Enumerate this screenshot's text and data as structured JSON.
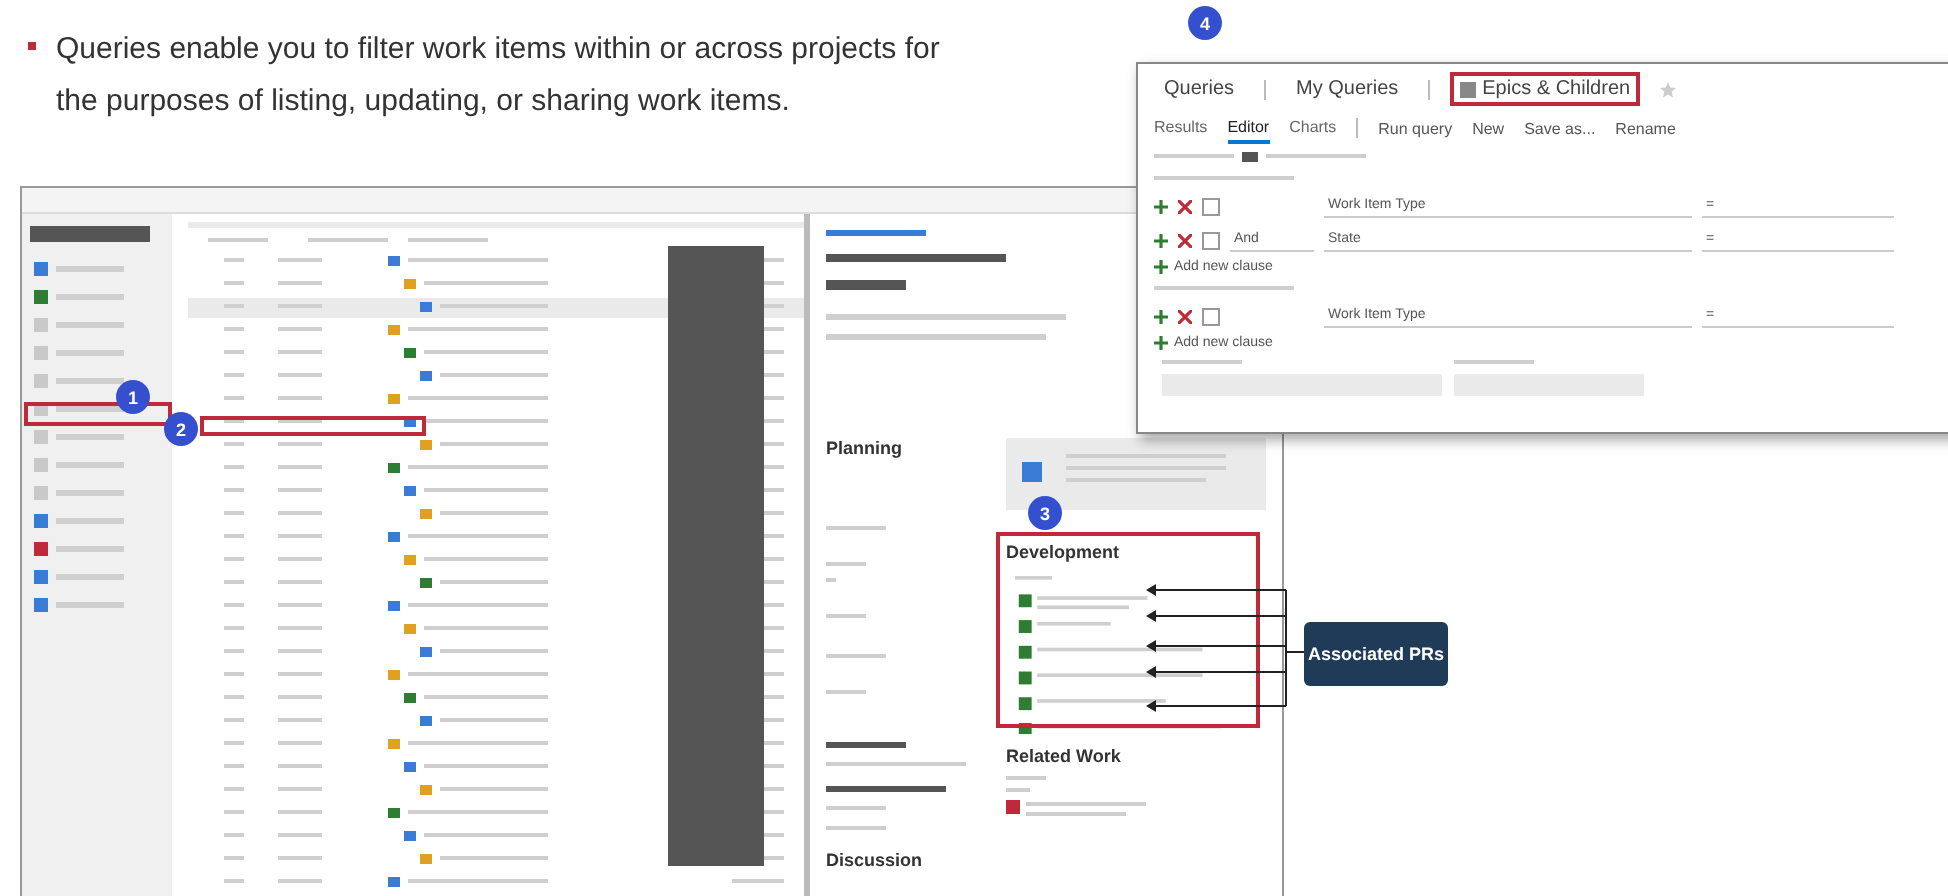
{
  "bullet": {
    "text": "Queries enable you to filter work items within or across projects for the purposes of listing, updating, or sharing work items."
  },
  "main_window": {
    "form_sections": [
      {
        "kind": "left",
        "label": "Planning"
      },
      {
        "kind": "right",
        "label": "Development"
      },
      {
        "kind": "right",
        "label": "Related Work"
      },
      {
        "kind": "left",
        "label": "Discussion"
      }
    ]
  },
  "editor_window": {
    "breadcrumb": [
      {
        "label": "Queries",
        "kind": "link"
      },
      {
        "label": "My Queries",
        "kind": "link"
      },
      {
        "label": "Epics & Children",
        "kind": "current"
      }
    ],
    "tabs": [
      {
        "label": "Results",
        "selected": false
      },
      {
        "label": "Editor",
        "selected": true
      },
      {
        "label": "Charts",
        "selected": false
      }
    ],
    "toolbar": [
      "Run query",
      "New",
      "Save as...",
      "Rename"
    ],
    "top_clauses": [
      {
        "checked": false,
        "field": "Work Item Type",
        "operator": "="
      },
      {
        "checked": false,
        "and_or": "And",
        "field": "State",
        "operator": "="
      }
    ],
    "linked_clauses": [
      {
        "checked": false,
        "field": "Work Item Type",
        "operator": "="
      }
    ],
    "add_clause": [
      "Add new clause",
      "Add new clause"
    ]
  },
  "callout": {
    "label": "Associated PRs"
  },
  "step_badges": [
    "1",
    "2",
    "3",
    "4"
  ]
}
